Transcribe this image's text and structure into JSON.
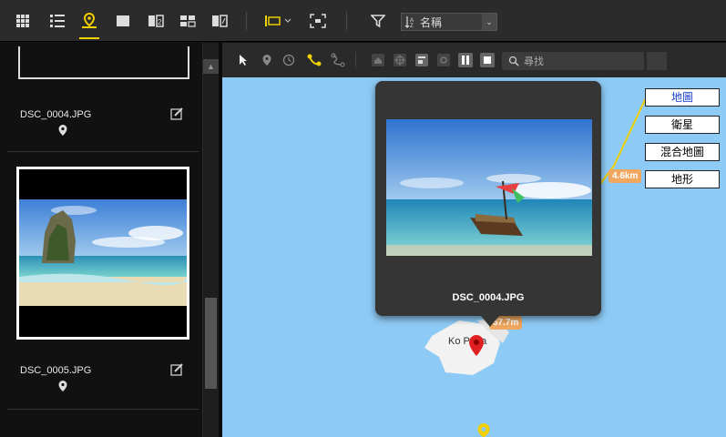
{
  "toolbar": {
    "sort_label": "名稱",
    "active_color": "#f0d000"
  },
  "photos": [
    {
      "filename": "DSC_0004.JPG"
    },
    {
      "filename": "DSC_0005.JPG"
    }
  ],
  "map_toolbar": {
    "search_placeholder": "尋找"
  },
  "map": {
    "map_types": [
      {
        "label": "地圖",
        "active": true
      },
      {
        "label": "衛星",
        "active": false
      },
      {
        "label": "混合地圖",
        "active": false
      },
      {
        "label": "地形",
        "active": false
      }
    ],
    "distance_1": "4.6km",
    "distance_2": "57.7m",
    "place_label": "Ko Poda",
    "popup_title": "DSC_0004.JPG",
    "colors": {
      "water": "#8dcaf5",
      "land": "#f0f0f0",
      "route": "#f0d000",
      "marker": "#e02020"
    }
  }
}
